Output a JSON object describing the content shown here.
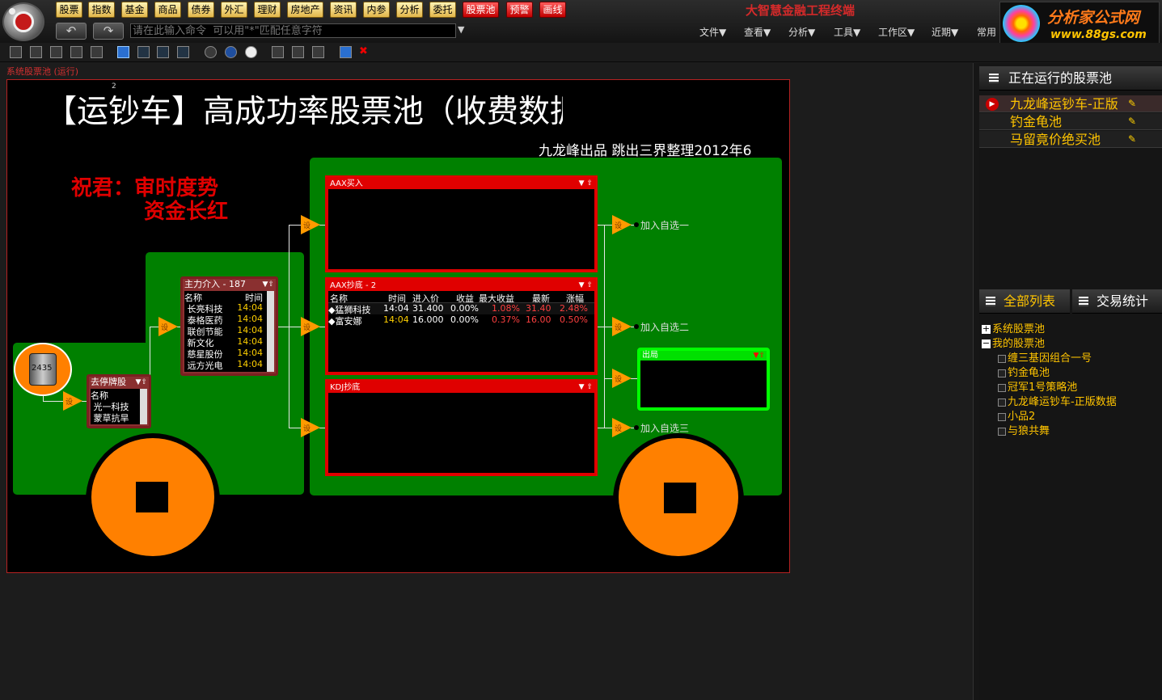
{
  "topbar": {
    "buttons_yellow": [
      "股票",
      "指数",
      "基金",
      "商品",
      "债券",
      "外汇",
      "理财",
      "房地产",
      "资讯",
      "内参",
      "分析",
      "委托"
    ],
    "buttons_red": [
      "股票池",
      "预警",
      "画线"
    ],
    "app_title": "大智慧金融工程终端",
    "command_placeholder": "请在此输入命令  可以用\"*\"匹配任意字符",
    "menus": [
      "文件▼",
      "查看▼",
      "分析▼",
      "工具▼",
      "工作区▼",
      "近期▼",
      "常用"
    ],
    "ad": {
      "title": "分析家公式网",
      "url": "www.88gs.com"
    }
  },
  "pool_label": "系统股票池 (运行)",
  "canvas": {
    "marker": "2",
    "title": "【运钞车】高成功率股票池（收费数据",
    "subtitle": "九龙峰出品  跳出三界整理2012年6",
    "bless_line1": "祝君：审时度势",
    "bless_line2": "资金长红",
    "coin_label": "2435",
    "arrow_text": "设",
    "panels": {
      "buy": {
        "title": "AAX买入"
      },
      "dip": {
        "title": "AAX抄底 - 2",
        "headers": [
          "名称",
          "时间",
          "进入价",
          "收益",
          "最大收益",
          "最新",
          "涨幅"
        ],
        "rows": [
          {
            "name": "◆猛狮科技",
            "time": "14:04",
            "entry": "31.400",
            "gain": "0.00%",
            "max_gain": "1.08%",
            "latest": "31.40",
            "change": "2.48%"
          },
          {
            "name": "◆富安娜",
            "time": "14:04",
            "entry": "16.000",
            "gain": "0.00%",
            "max_gain": "0.37%",
            "latest": "16.00",
            "change": "0.50%"
          }
        ]
      },
      "kdj": {
        "title": "KDJ抄底"
      },
      "main": {
        "title": "主力介入 - 187",
        "headers": [
          "名称",
          "时间"
        ],
        "rows": [
          {
            "name": "长亮科技",
            "time": "14:04"
          },
          {
            "name": "泰格医药",
            "time": "14:04"
          },
          {
            "name": "联创节能",
            "time": "14:04"
          },
          {
            "name": "新文化",
            "time": "14:04"
          },
          {
            "name": "慈星股份",
            "time": "14:04"
          },
          {
            "name": "远方光电",
            "time": "14:04"
          }
        ]
      },
      "limit": {
        "title": "去停牌股",
        "headers": [
          "名称"
        ],
        "rows": [
          {
            "name": "光一科技"
          },
          {
            "name": "蒙草抗旱"
          }
        ]
      },
      "out": {
        "title": "出局"
      }
    },
    "add_labels": [
      "加入自选一",
      "加入自选二",
      "加入自选三"
    ]
  },
  "right_panel": {
    "running_header": "正在运行的股票池",
    "running_items": [
      "九龙峰运钞车-正版",
      "钓金龟池",
      "马留竟价绝买池"
    ],
    "tabs": [
      "全部列表",
      "交易统计"
    ],
    "tree": {
      "system": "系统股票池",
      "mine": "我的股票池",
      "children": [
        "缠三基因组合一号",
        "钓金龟池",
        "冠军1号策略池",
        "九龙峰运钞车-正版数据",
        "小品2",
        "与狼共舞"
      ]
    }
  },
  "colors": {
    "accent_red": "#e00000",
    "truck_green": "#008000",
    "wheel_orange": "#ff8000",
    "out_green": "#00ff00"
  }
}
